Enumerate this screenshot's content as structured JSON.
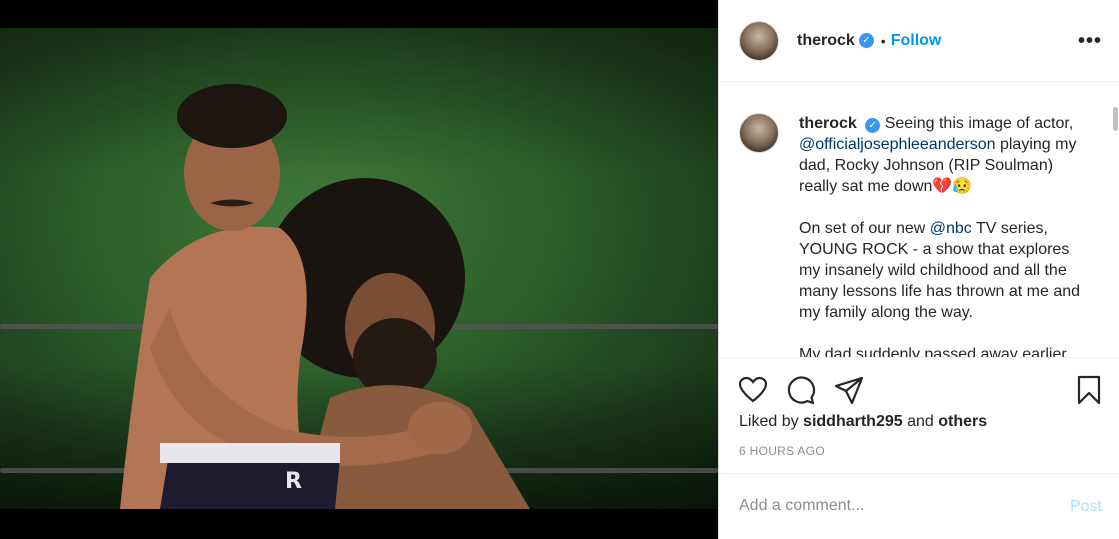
{
  "post": {
    "username": "therock",
    "verified_mark": "✓",
    "separator": "•",
    "follow_label": "Follow",
    "more_label": "•••"
  },
  "caption": {
    "username": "therock",
    "verified_mark": "✓",
    "line1": "Seeing this image of actor,",
    "mention1": "@officialjosephleeanderson",
    "line2": " playing my dad, Rocky Johnson (RIP Soulman) really sat me down💔😥",
    "para2_pre": "On set of our new ",
    "mention2": "@nbc",
    "para2_post": " TV series, YOUNG ROCK - a show that explores my insanely wild childhood and all the many lessons life has thrown at me and my family along the way.",
    "para3": "My dad suddenly passed away earlier"
  },
  "icons": [
    "heart-icon",
    "comment-icon",
    "share-icon",
    "bookmark-icon"
  ],
  "likes": {
    "prefix": "Liked by ",
    "user": "siddharth295",
    "middle": " and ",
    "others": "others"
  },
  "timestamp": "6 HOURS AGO",
  "comment": {
    "placeholder": "Add a comment...",
    "post_label": "Post"
  },
  "colors": {
    "accent": "#0095f6",
    "verified": "#3897f0",
    "post_disabled": "#b2dffc"
  }
}
